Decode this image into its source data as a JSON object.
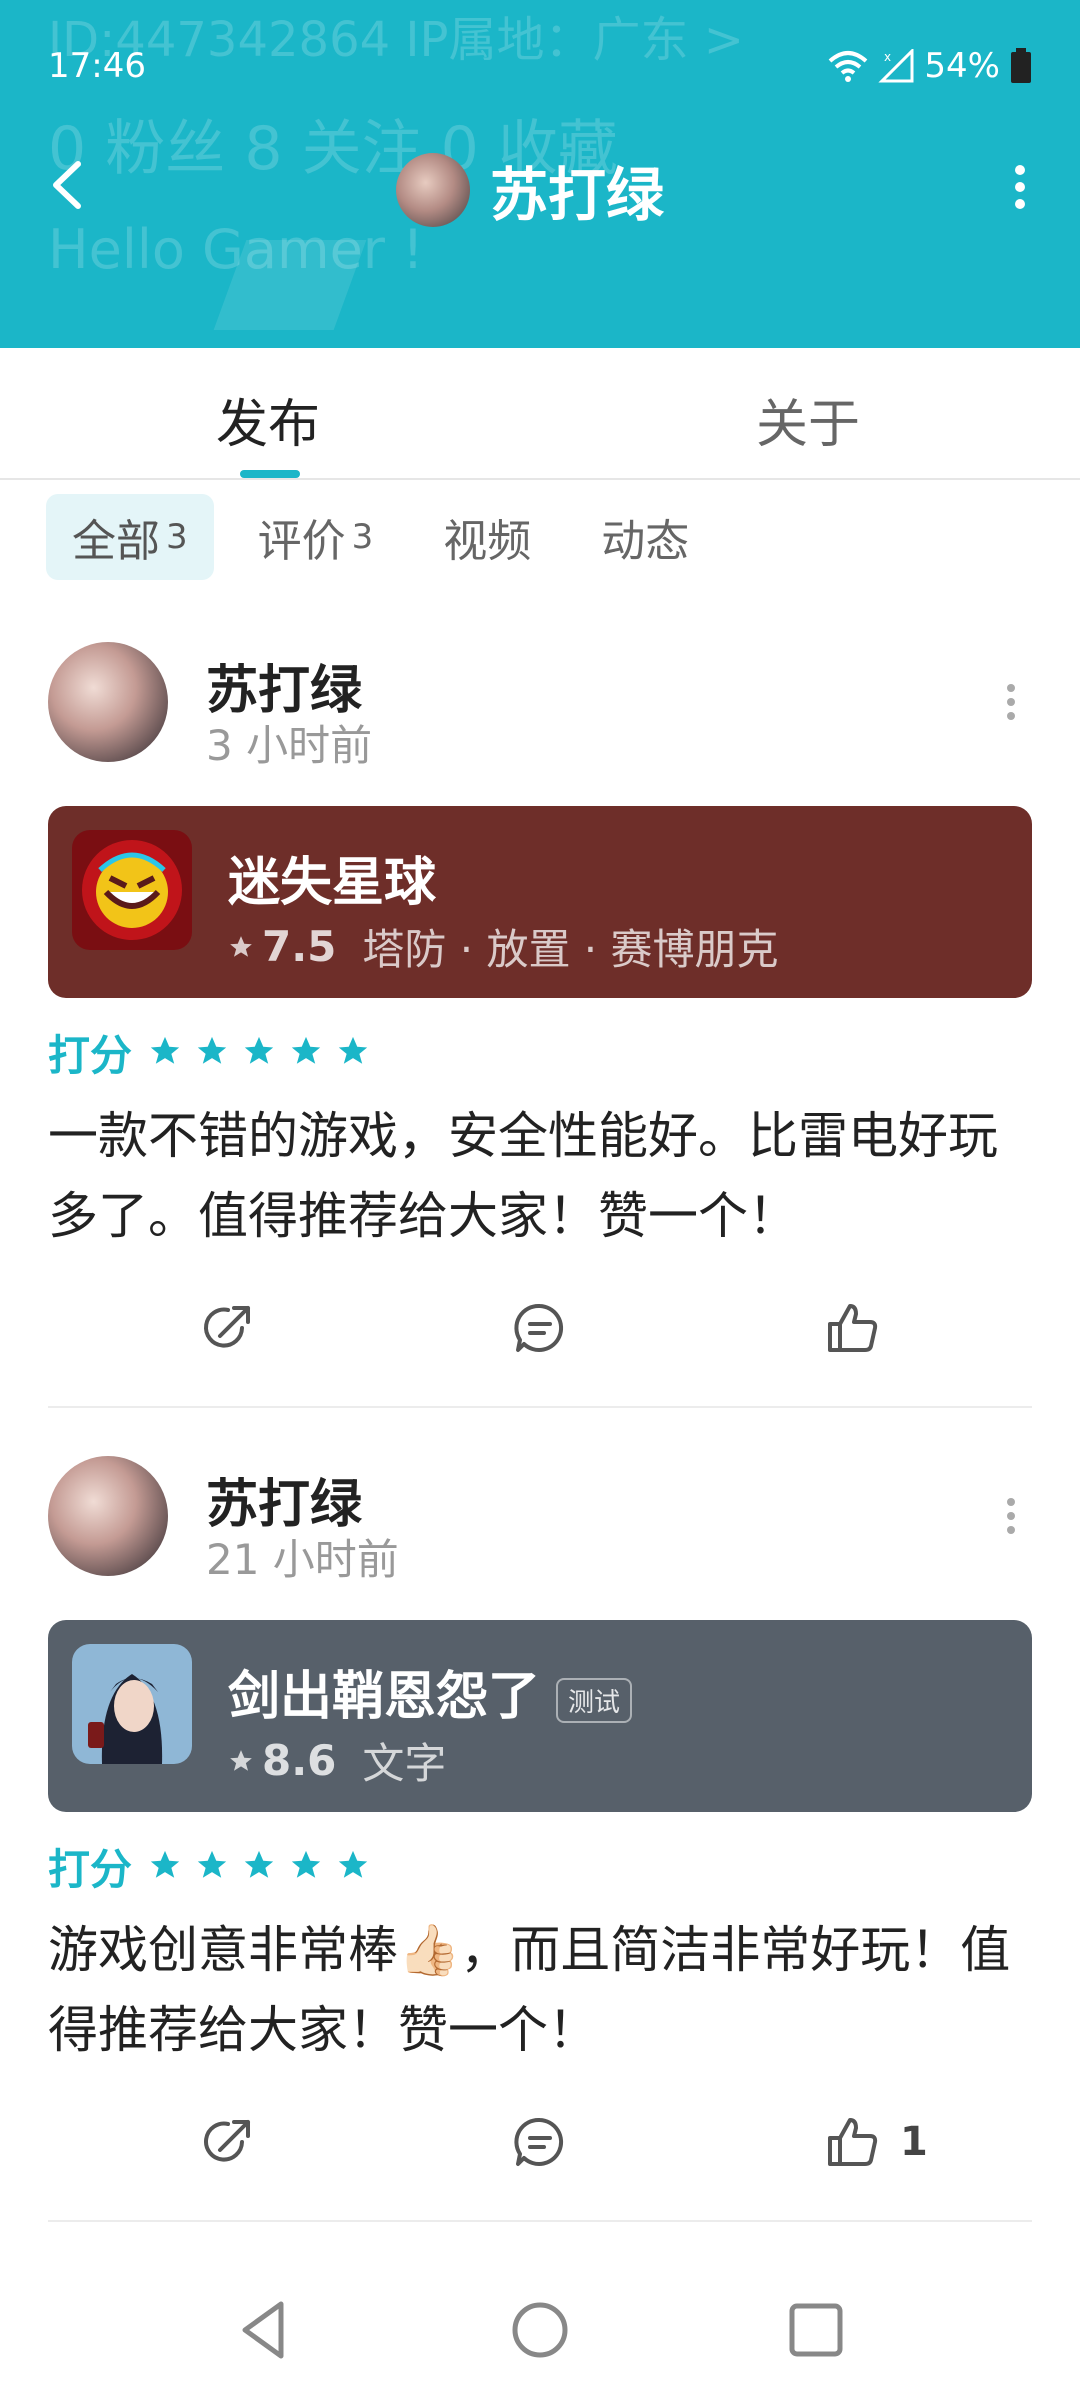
{
  "status_bar": {
    "time": "17:46",
    "battery": "54%"
  },
  "header_bg": {
    "user_id_line": "ID:447342864   IP属地：广东 >",
    "stats_line": "0 粉丝   8 关注   0 收藏",
    "bio": "Hello Gamer !"
  },
  "header": {
    "title": "苏打绿"
  },
  "tabs": [
    {
      "label": "发布"
    },
    {
      "label": "关于"
    }
  ],
  "filters": [
    {
      "label": "全部",
      "count": "3"
    },
    {
      "label": "评价",
      "count": "3"
    },
    {
      "label": "视频",
      "count": ""
    },
    {
      "label": "动态",
      "count": ""
    }
  ],
  "posts": [
    {
      "author": "苏打绿",
      "time": "3 小时前",
      "game": {
        "name": "迷失星球",
        "score": "7.5",
        "tags": "塔防 · 放置 · 赛博朋克",
        "badge": "",
        "card_color": "#6e2e29"
      },
      "rating_label": "打分",
      "rating_stars": 5,
      "content": "一款不错的游戏，安全性能好。比雷电好玩多了。值得推荐给大家！赞一个！",
      "like_count": ""
    },
    {
      "author": "苏打绿",
      "time": "21 小时前",
      "game": {
        "name": "剑出鞘恩怨了",
        "score": "8.6",
        "tags": "文字",
        "badge": "测试",
        "card_color": "#57606a"
      },
      "rating_label": "打分",
      "rating_stars": 5,
      "content": "游戏创意非常棒👍🏻，而且简洁非常好玩！值得推荐给大家！赞一个！",
      "like_count": "1"
    }
  ],
  "colors": {
    "accent": "#1bb6c8"
  }
}
